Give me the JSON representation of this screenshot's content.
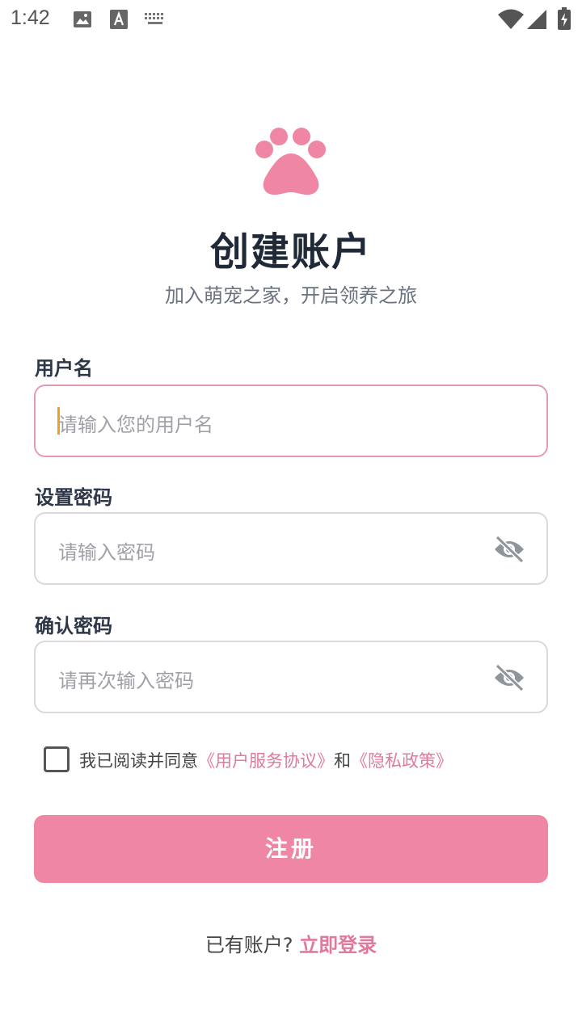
{
  "status_bar": {
    "time": "1:42",
    "icons": [
      "image-icon",
      "text-a-icon",
      "keyboard-icon",
      "wifi-icon",
      "signal-icon",
      "battery-charging-icon"
    ]
  },
  "header": {
    "logo_icon": "paw-icon",
    "title": "创建账户",
    "subtitle": "加入萌宠之家，开启领养之旅"
  },
  "form": {
    "username": {
      "label": "用户名",
      "placeholder": "请输入您的用户名",
      "value": ""
    },
    "password": {
      "label": "设置密码",
      "placeholder": "请输入密码",
      "value": "",
      "toggle_icon": "eye-off-icon"
    },
    "confirm_password": {
      "label": "确认密码",
      "placeholder": "请再次输入密码",
      "value": "",
      "toggle_icon": "eye-off-icon"
    }
  },
  "agreement": {
    "checked": false,
    "prefix": "我已阅读并同意",
    "terms_link": "《用户服务协议》",
    "conjunction": "和",
    "privacy_link": "《隐私政策》"
  },
  "register_button": {
    "label": "注册"
  },
  "login_prompt": {
    "text": "已有账户? ",
    "link": "立即登录"
  },
  "colors": {
    "accent": "#ef86a3",
    "link": "#e07a9c",
    "title": "#1f2937",
    "focus_border": "#e59ab4",
    "caret": "#f0a020"
  }
}
